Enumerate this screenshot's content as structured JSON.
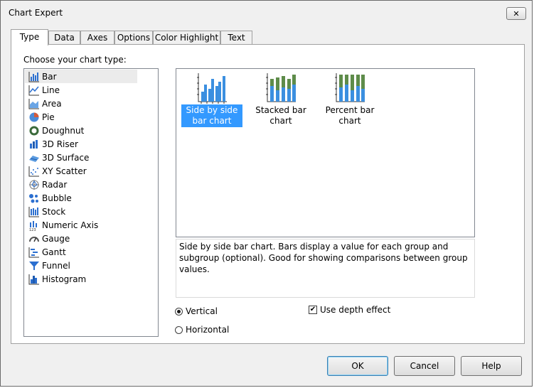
{
  "window": {
    "title": "Chart Expert"
  },
  "tabs": [
    {
      "label": "Type"
    },
    {
      "label": "Data"
    },
    {
      "label": "Axes"
    },
    {
      "label": "Options"
    },
    {
      "label": "Color Highlight"
    },
    {
      "label": "Text"
    }
  ],
  "type_panel": {
    "choose_label": "Choose your chart type:",
    "chart_types": [
      {
        "label": "Bar"
      },
      {
        "label": "Line"
      },
      {
        "label": "Area"
      },
      {
        "label": "Pie"
      },
      {
        "label": "Doughnut"
      },
      {
        "label": "3D Riser"
      },
      {
        "label": "3D Surface"
      },
      {
        "label": "XY Scatter"
      },
      {
        "label": "Radar"
      },
      {
        "label": "Bubble"
      },
      {
        "label": "Stock"
      },
      {
        "label": "Numeric Axis"
      },
      {
        "label": "Gauge"
      },
      {
        "label": "Gantt"
      },
      {
        "label": "Funnel"
      },
      {
        "label": "Histogram"
      }
    ],
    "subtypes": [
      {
        "label": "Side by side bar chart"
      },
      {
        "label": "Stacked bar chart"
      },
      {
        "label": "Percent bar chart"
      }
    ],
    "description": "Side by side bar chart. Bars display a value for each group and subgroup (optional). Good for showing comparisons between group values.",
    "orientation": {
      "vertical": "Vertical",
      "horizontal": "Horizontal",
      "selected": "Vertical"
    },
    "depth_effect": {
      "label": "Use depth effect",
      "checked": true
    }
  },
  "buttons": {
    "ok": "OK",
    "cancel": "Cancel",
    "help": "Help"
  },
  "colors": {
    "selection": "#3399ff",
    "bar_blue": "#3b8fe0",
    "bar_green": "#5e8c4a"
  }
}
